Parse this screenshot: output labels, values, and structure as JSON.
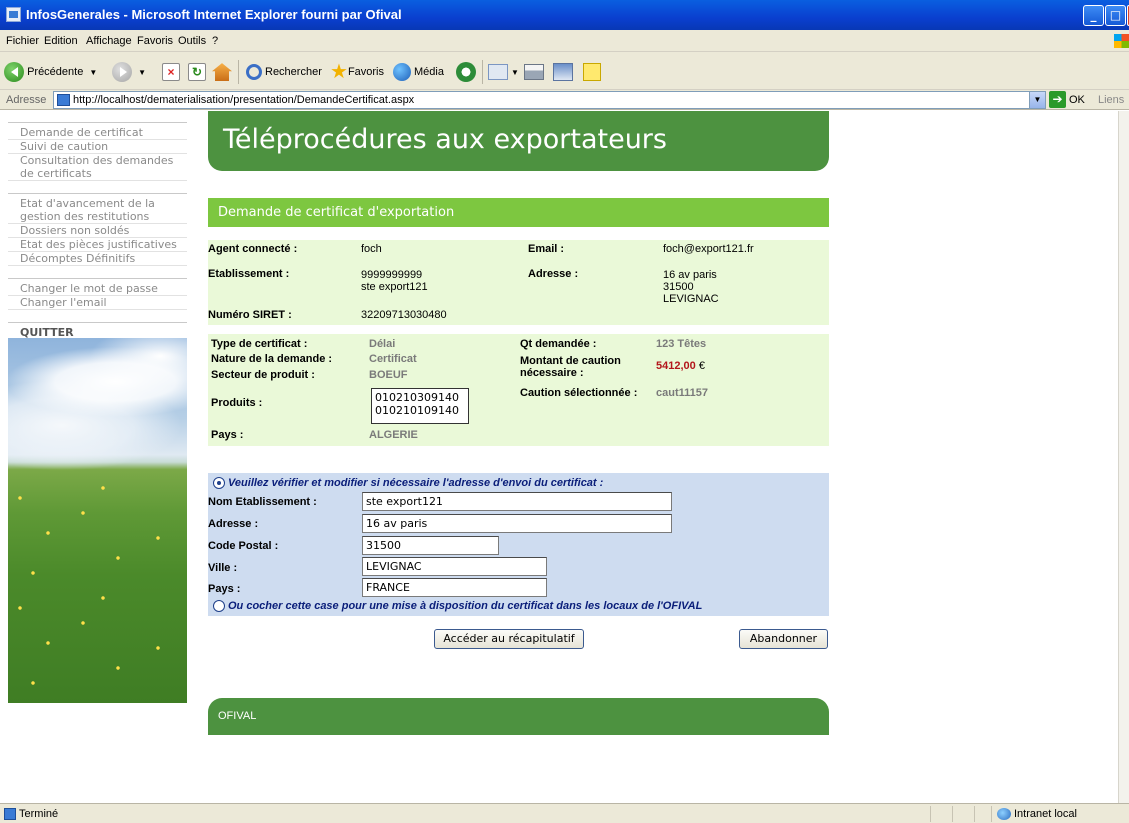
{
  "window": {
    "title": "InfosGenerales - Microsoft Internet Explorer fourni par Ofival"
  },
  "menu": [
    "Fichier",
    "Edition",
    "Affichage",
    "Favoris",
    "Outils",
    "?"
  ],
  "toolbar": {
    "back_label": "Précédente",
    "search_label": "Rechercher",
    "favorites_label": "Favoris",
    "media_label": "Média"
  },
  "address": {
    "label": "Adresse",
    "url": "http://localhost/dematerialisation/presentation/DemandeCertificat.aspx",
    "go_label": "OK",
    "links_label": "Liens"
  },
  "sidebar": {
    "group1": [
      "Demande de certificat",
      "Suivi de caution",
      "Consultation des demandes de certificats"
    ],
    "group2": [
      "Etat d'avancement de la gestion des restitutions",
      "Dossiers non soldés",
      "Etat des pièces justificatives",
      "Décomptes Définitifs"
    ],
    "group3": [
      "Changer le mot de passe",
      "Changer l'email"
    ],
    "quit": "QUITTER"
  },
  "banner": {
    "title": "Téléprocédures aux exportateurs"
  },
  "page_header": "Demande de certificat d'exportation",
  "agent": {
    "agent_label": "Agent connecté :",
    "agent_value": "foch",
    "email_label": "Email :",
    "email_value": "foch@export121.fr",
    "etab_label": "Etablissement :",
    "etab_line1": "9999999999",
    "etab_line2": "ste export121",
    "adresse_label": "Adresse :",
    "adresse_line1": "16 av paris",
    "adresse_line2": "31500",
    "adresse_line3": "LEVIGNAC",
    "siret_label": "Numéro SIRET :",
    "siret_value": "32209713030480"
  },
  "certificate": {
    "type_label": "Type de certificat :",
    "type_value": "Délai",
    "nature_label": "Nature de la demande :",
    "nature_value": "Certificat",
    "secteur_label": "Secteur de produit :",
    "secteur_value": "BOEUF",
    "produits_label": "Produits :",
    "produits": [
      "010210309140",
      "010210109140"
    ],
    "pays_label": "Pays :",
    "pays_value": "ALGERIE",
    "qt_label": "Qt demandée :",
    "qt_value": "123 Têtes",
    "montant_label_line1": "Montant de caution",
    "montant_label_line2": "nécessaire :",
    "montant_value": "5412,00",
    "montant_currency": "€",
    "caution_label": "Caution sélectionnée :",
    "caution_value": "caut11157"
  },
  "shipping": {
    "verify_text": "Veuillez vérifier et modifier si nécessaire l'adresse d'envoi du certificat :",
    "nom_label": "Nom Etablissement :",
    "nom_value": "ste export121",
    "adresse_label": "Adresse :",
    "adresse_value": "16 av paris",
    "cp_label": "Code Postal :",
    "cp_value": "31500",
    "ville_label": "Ville :",
    "ville_value": "LEVIGNAC",
    "pays_label": "Pays :",
    "pays_value": "FRANCE",
    "ofival_text": "Ou cocher cette case pour une mise à disposition du certificat dans les locaux de l'OFIVAL"
  },
  "actions": {
    "recap_label": "Accéder au récapitulatif",
    "cancel_label": "Abandonner"
  },
  "footer": {
    "text": "OFIVAL"
  },
  "status": {
    "text": "Terminé",
    "zone": "Intranet local"
  }
}
